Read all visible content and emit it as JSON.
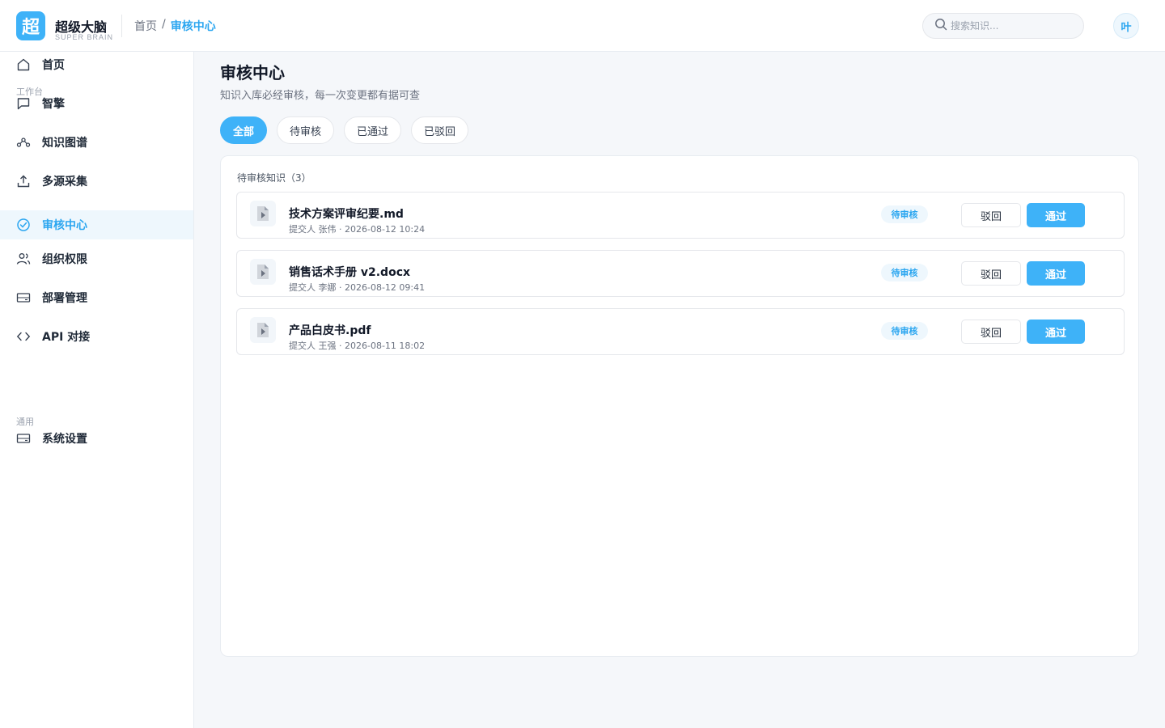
{
  "brand": {
    "logo_char": "超",
    "name": "超级大脑",
    "subtitle": "SUPER BRAIN"
  },
  "breadcrumb": {
    "home": "首页",
    "separator": "/",
    "current": "审核中心"
  },
  "search": {
    "placeholder": "搜索知识..."
  },
  "user": {
    "avatar_char": "叶"
  },
  "colors": {
    "accent": "#3eb2f8",
    "accent_text": "#2ba6f0",
    "active_bg": "#eef7fd"
  },
  "sidebar": {
    "top_item": {
      "label": "首页",
      "icon": "home-icon"
    },
    "section_workbench": "工作台",
    "items": [
      {
        "label": "智擎",
        "icon": "chat-icon"
      },
      {
        "label": "知识图谱",
        "icon": "graph-icon"
      },
      {
        "label": "多源采集",
        "icon": "upload-icon"
      },
      {
        "label": "审核中心",
        "icon": "check-circle-icon",
        "active": true
      },
      {
        "label": "组织权限",
        "icon": "users-icon"
      },
      {
        "label": "部署管理",
        "icon": "server-icon"
      },
      {
        "label": "API 对接",
        "icon": "code-icon"
      }
    ],
    "section_general": "通用",
    "settings": {
      "label": "系统设置",
      "icon": "settings-icon"
    }
  },
  "main": {
    "title": "审核中心",
    "subtitle": "知识入库必经审核，每一次变更都有据可查",
    "tabs": [
      {
        "label": "全部",
        "active": true
      },
      {
        "label": "待审核"
      },
      {
        "label": "已通过"
      },
      {
        "label": "已驳回"
      }
    ],
    "list_title": "待审核知识（3）",
    "items": [
      {
        "name": "技术方案评审纪要.md",
        "meta": "提交人 张伟 · 2026-08-12 10:24",
        "status": "待审核",
        "reject": "驳回",
        "approve": "通过"
      },
      {
        "name": "销售话术手册 v2.docx",
        "meta": "提交人 李娜 · 2026-08-12 09:41",
        "status": "待审核",
        "reject": "驳回",
        "approve": "通过"
      },
      {
        "name": "产品白皮书.pdf",
        "meta": "提交人 王强 · 2026-08-11 18:02",
        "status": "待审核",
        "reject": "驳回",
        "approve": "通过"
      }
    ]
  }
}
